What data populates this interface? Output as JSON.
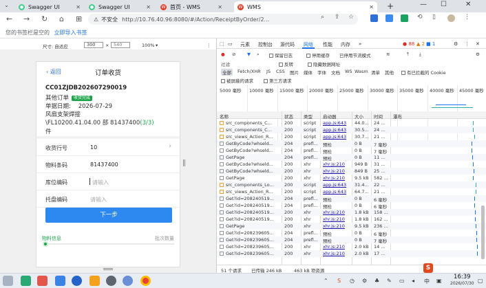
{
  "tabs": [
    {
      "title": "Swagger UI",
      "active": false
    },
    {
      "title": "Swagger UI",
      "active": false
    },
    {
      "title": "首页 - WMS",
      "active": false
    },
    {
      "title": "WMS",
      "active": true
    }
  ],
  "address": {
    "security": "不安全",
    "url": "http://10.76.40.96:8080/#/Action/ReceiptByOrder/2..."
  },
  "bookmarks": {
    "text": "您的书签栏是空的",
    "link": "立即导入书签"
  },
  "device_toolbar": {
    "size_label": "尺寸: 自适应",
    "width": "300",
    "height": "540",
    "zoom": "100%"
  },
  "mobile": {
    "back_label": "返回",
    "title": "订单收货",
    "order_no": "CC01ZJDB202607290019",
    "order_type": "其他订单",
    "status_badge": "收货完成",
    "date_label": "单据日期:",
    "date_value": "2026-07-29",
    "material_name": "风扇支架焊接",
    "material_spec": "\\FL10200.41.04.00 部 81437400",
    "progress": "(3/3)",
    "unit": "件",
    "fields": [
      {
        "label": "收货行号",
        "value": "10",
        "placeholder": ""
      },
      {
        "label": "物料条码",
        "value": "81437400",
        "placeholder": ""
      },
      {
        "label": "库位编码",
        "value": "",
        "placeholder": "请输入"
      },
      {
        "label": "托盘编码",
        "value": "",
        "placeholder": "请输入"
      }
    ],
    "next_button": "下一步",
    "footer_left": "物料信息",
    "footer_right": "批次数量"
  },
  "devtools": {
    "tabs": [
      "元素",
      "控制台",
      "源代码",
      "网络",
      "性能",
      "内存"
    ],
    "error_count": "88",
    "warn_count": "2",
    "info_count": "1",
    "preserve_log": "保留日志",
    "disable_cache": "停用缓存",
    "throttle": "已停用节流模式",
    "filter_label": "过滤",
    "invert": "反转",
    "hide_data_urls": "隐藏数据网址",
    "type_filters": [
      "全部",
      "Fetch/XHR",
      "JS",
      "CSS",
      "图片",
      "媒体",
      "字体",
      "文档",
      "WS",
      "Wasm",
      "清单",
      "其他"
    ],
    "blocked_cookies": "有已拦截的 Cookie",
    "blocked_requests": "被屏蔽的请求",
    "third_party": "第三方请求",
    "timeline_ticks": [
      "5000 毫秒",
      "10000 毫秒",
      "15000 毫秒",
      "20000 毫秒",
      "25000 毫秒",
      "30000 毫秒",
      "35000 毫秒",
      "40000 毫秒",
      "45000 毫秒"
    ],
    "columns": [
      "名称",
      "状态",
      "类型",
      "启动器",
      "大小",
      "时间",
      "瀑布"
    ],
    "rows": [
      {
        "name": "src_components_C...",
        "status": "200",
        "type": "script",
        "initiator": "app.js:643",
        "size": "44.0...",
        "time": "24 ...",
        "js": true
      },
      {
        "name": "src_components_C...",
        "status": "200",
        "type": "script",
        "initiator": "app.js:643",
        "size": "30.5...",
        "time": "24 ...",
        "js": true
      },
      {
        "name": "src_views_Action_R...",
        "status": "200",
        "type": "script",
        "initiator": "app.js:643",
        "size": "30.7...",
        "time": "21 ...",
        "js": true
      },
      {
        "name": "GetByCode?whseld...",
        "status": "204",
        "type": "prefl...",
        "initiator": "预检",
        "size": "0 B",
        "time": "7 毫秒",
        "js": false
      },
      {
        "name": "GetByCode?whseld...",
        "status": "204",
        "type": "prefl...",
        "initiator": "预检",
        "size": "0 B",
        "time": "7 毫秒",
        "js": false
      },
      {
        "name": "GetPage",
        "status": "204",
        "type": "prefl...",
        "initiator": "预检",
        "size": "0 B",
        "time": "11 ...",
        "js": false
      },
      {
        "name": "GetByCode?whseld...",
        "status": "200",
        "type": "xhr",
        "initiator": "xhr.js:210",
        "size": "949 B",
        "time": "31 ...",
        "js": false
      },
      {
        "name": "GetByCode?whseld...",
        "status": "200",
        "type": "xhr",
        "initiator": "xhr.js:210",
        "size": "849 B",
        "time": "25 ...",
        "js": false
      },
      {
        "name": "GetPage",
        "status": "200",
        "type": "xhr",
        "initiator": "xhr.js:210",
        "size": "9.5 kB",
        "time": "582 ...",
        "js": false
      },
      {
        "name": "src_components_Lo...",
        "status": "200",
        "type": "script",
        "initiator": "app.js:643",
        "size": "31.4...",
        "time": "22 ...",
        "js": true
      },
      {
        "name": "src_views_Action_R...",
        "status": "200",
        "type": "script",
        "initiator": "app.js:643",
        "size": "64.7...",
        "time": "21 ...",
        "js": true
      },
      {
        "name": "Get?id=208240519...",
        "status": "204",
        "type": "prefl...",
        "initiator": "预检",
        "size": "0 B",
        "time": "6 毫秒",
        "js": false
      },
      {
        "name": "Get?id=208240519...",
        "status": "204",
        "type": "prefl...",
        "initiator": "预检",
        "size": "0 B",
        "time": "6 毫秒",
        "js": false
      },
      {
        "name": "Get?id=208240519...",
        "status": "200",
        "type": "xhr",
        "initiator": "xhr.js:210",
        "size": "1.8 kB",
        "time": "158 ...",
        "js": false
      },
      {
        "name": "Get?id=208240519...",
        "status": "200",
        "type": "xhr",
        "initiator": "xhr.js:210",
        "size": "1.8 kB",
        "time": "162 ...",
        "js": false
      },
      {
        "name": "GetPage",
        "status": "200",
        "type": "xhr",
        "initiator": "xhr.js:210",
        "size": "9.5 kB",
        "time": "236 ...",
        "js": false
      },
      {
        "name": "Get?id=208239605...",
        "status": "204",
        "type": "prefl...",
        "initiator": "预检",
        "size": "0 B",
        "time": "6 毫秒",
        "js": false
      },
      {
        "name": "Get?id=208239605...",
        "status": "204",
        "type": "prefl...",
        "initiator": "预检",
        "size": "0 B",
        "time": "7 毫秒",
        "js": false
      },
      {
        "name": "Get?id=208239605...",
        "status": "200",
        "type": "xhr",
        "initiator": "xhr.js:210",
        "size": "2.0 kB",
        "time": "14 ...",
        "js": false
      },
      {
        "name": "Get?id=208239605...",
        "status": "200",
        "type": "xhr",
        "initiator": "xhr.js:210",
        "size": "2.0 kB",
        "time": "17 ...",
        "js": false
      }
    ],
    "status_requests": "51 个请求",
    "status_transferred": "已传输 246 kB",
    "status_resources": "463 kB 项资源"
  },
  "taskbar": {
    "time": "16:39",
    "date": "2026/07/30",
    "ime_label": "中"
  }
}
